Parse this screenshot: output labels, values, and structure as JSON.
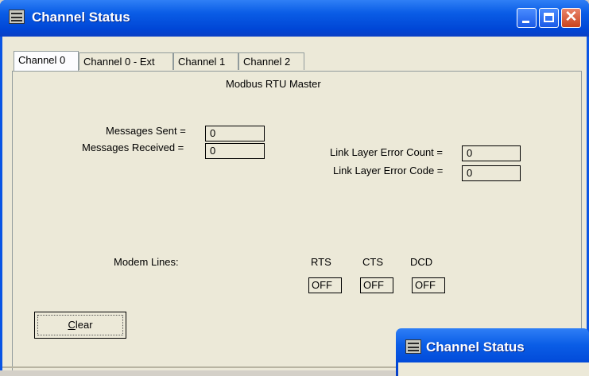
{
  "window": {
    "title": "Channel Status",
    "controls": {
      "minimize": "minimize",
      "maximize": "maximize",
      "close": "close"
    }
  },
  "tabs": [
    {
      "label": "Channel 0",
      "active": true
    },
    {
      "label": "Channel 0 - Ext",
      "active": false
    },
    {
      "label": "Channel 1",
      "active": false
    },
    {
      "label": "Channel 2",
      "active": false
    }
  ],
  "panel": {
    "heading": "Modbus RTU Master",
    "messages_sent_label": "Messages Sent =",
    "messages_sent_value": "0",
    "messages_received_label": "Messages Received =",
    "messages_received_value": "0",
    "link_error_count_label": "Link Layer Error Count =",
    "link_error_count_value": "0",
    "link_error_code_label": "Link Layer Error Code =",
    "link_error_code_value": "0",
    "modem_lines_label": "Modem Lines:",
    "modem": [
      {
        "name": "RTS",
        "value": "OFF"
      },
      {
        "name": "CTS",
        "value": "OFF"
      },
      {
        "name": "DCD",
        "value": "OFF"
      }
    ],
    "clear_button": {
      "underlined": "C",
      "rest": "lear"
    }
  },
  "second_window": {
    "title": "Channel Status"
  }
}
